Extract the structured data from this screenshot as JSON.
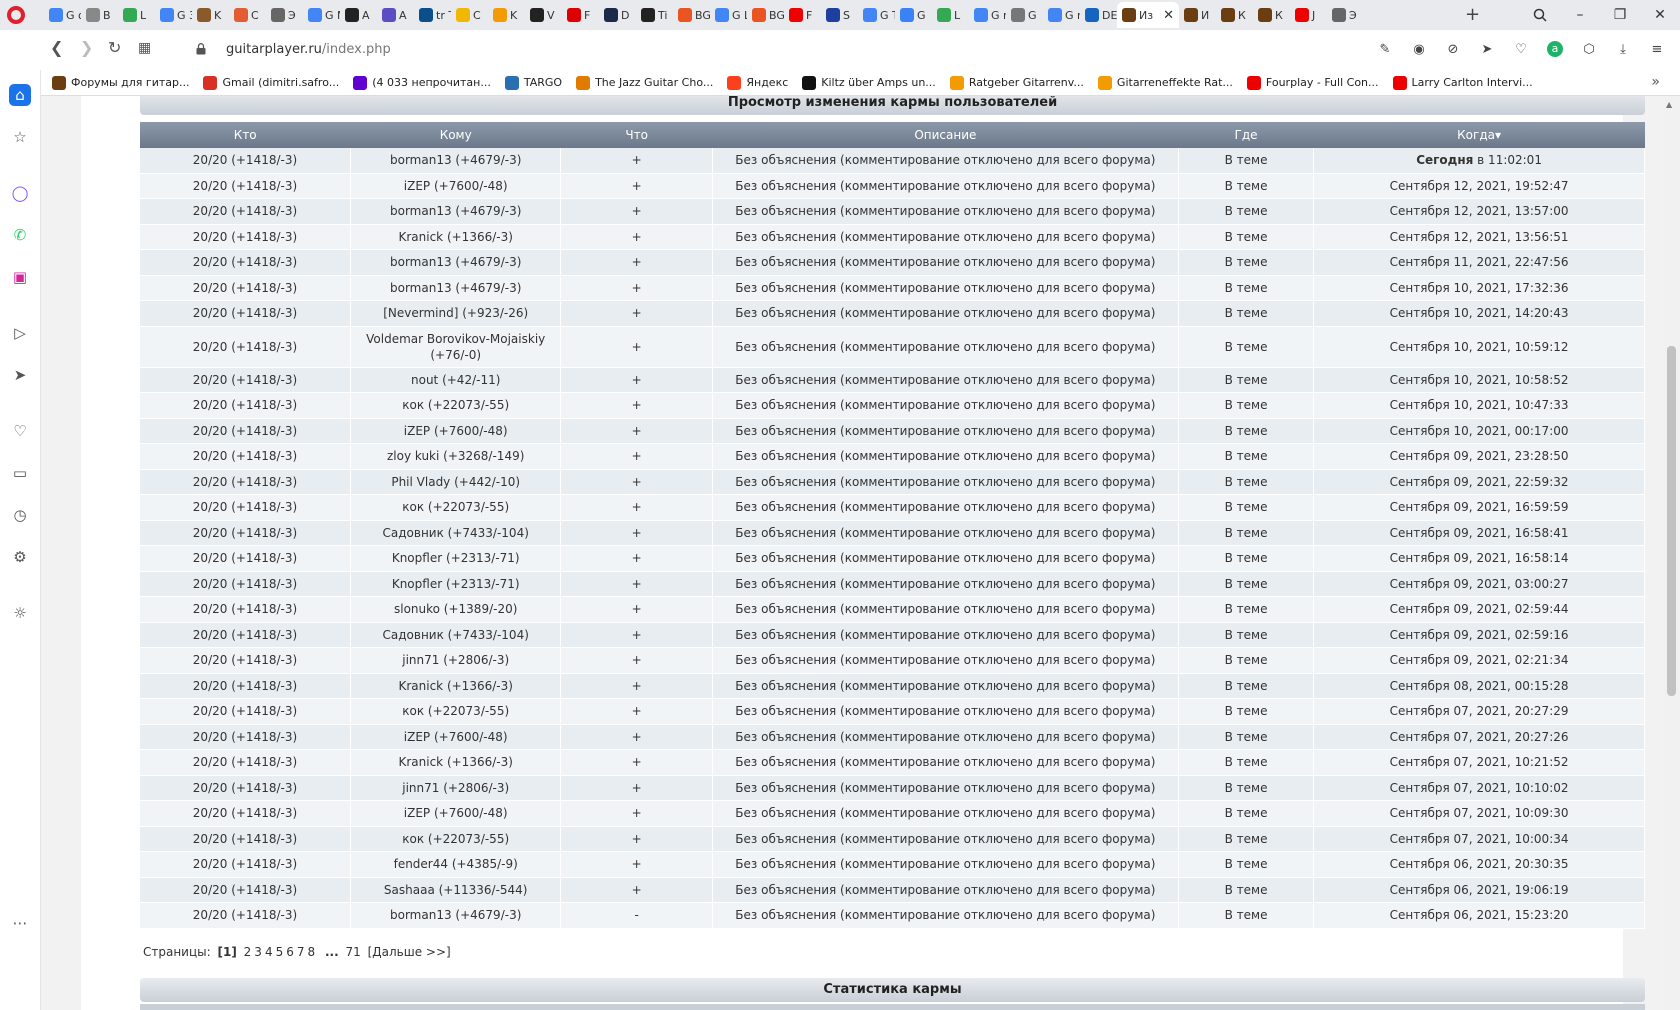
{
  "browser": {
    "tabs": [
      {
        "label": "G o",
        "color": "#4285f4"
      },
      {
        "label": "B",
        "color": "#888"
      },
      {
        "label": "L",
        "color": "#34a853"
      },
      {
        "label": "G 3",
        "color": "#4285f4"
      },
      {
        "label": "K",
        "color": "#8b5a2b"
      },
      {
        "label": "C",
        "color": "#e25d33"
      },
      {
        "label": "Э",
        "color": "#666"
      },
      {
        "label": "G M",
        "color": "#4285f4"
      },
      {
        "label": "A",
        "color": "#222"
      },
      {
        "label": "A",
        "color": "#5b4ec4"
      },
      {
        "label": "tr T",
        "color": "#0b4f8a"
      },
      {
        "label": "C",
        "color": "#f2b705"
      },
      {
        "label": "K",
        "color": "#f29b05"
      },
      {
        "label": "V",
        "color": "#222"
      },
      {
        "label": "F",
        "color": "#d00"
      },
      {
        "label": "D",
        "color": "#1b2a4a"
      },
      {
        "label": "Ti",
        "color": "#222"
      },
      {
        "label": "BG L",
        "color": "#e95420"
      },
      {
        "label": "G L",
        "color": "#4285f4"
      },
      {
        "label": "BG A",
        "color": "#e95420"
      },
      {
        "label": "F",
        "color": "#e00"
      },
      {
        "label": "S",
        "color": "#1f3fa0"
      },
      {
        "label": "G T",
        "color": "#4285f4"
      },
      {
        "label": "G",
        "color": "#3a82f7"
      },
      {
        "label": "L",
        "color": "#34a853"
      },
      {
        "label": "G r",
        "color": "#4285f4"
      },
      {
        "label": "G",
        "color": "#777"
      },
      {
        "label": "G r",
        "color": "#4285f4"
      },
      {
        "label": "DE h",
        "color": "#1565c0"
      }
    ],
    "active_tab": {
      "label": "Из",
      "color": "#6b3e12"
    },
    "tabs_after": [
      {
        "label": "И",
        "color": "#6b3e12"
      },
      {
        "label": "К",
        "color": "#6b3e12"
      },
      {
        "label": "К",
        "color": "#6b3e12"
      },
      {
        "label": "J",
        "color": "#e00"
      },
      {
        "label": "Э",
        "color": "#666"
      }
    ],
    "url_host": "guitarplayer.ru",
    "url_path": "/index.php",
    "bookmarks": [
      {
        "label": "Форумы для гитар...",
        "color": "#6b3e12"
      },
      {
        "label": "Gmail (dimitri.safro...",
        "color": "#d93025"
      },
      {
        "label": "(4 033 непрочитан...",
        "color": "#5f01d1"
      },
      {
        "label": "TARGO",
        "color": "#2a6fb0"
      },
      {
        "label": "The Jazz Guitar Cho...",
        "color": "#e07b00"
      },
      {
        "label": "Яндекс",
        "color": "#fc3f1d"
      },
      {
        "label": "Kiltz über Amps un...",
        "color": "#111"
      },
      {
        "label": "Ratgeber Gitarrenv...",
        "color": "#f29b05"
      },
      {
        "label": "Gitarreneffekte Rat...",
        "color": "#f29b05"
      },
      {
        "label": "Fourplay - Full Con...",
        "color": "#e00"
      },
      {
        "label": "Larry Carlton Intervi...",
        "color": "#e00"
      }
    ]
  },
  "page": {
    "title": "Просмотр изменения кармы пользователей",
    "columns": [
      "Кто",
      "Кому",
      "Что",
      "Описание",
      "Где",
      "Когда"
    ],
    "sort_indicator": "▾",
    "rows": [
      {
        "who": "20/20 (+1418/-3)",
        "to": "borman13 (+4679/-3)",
        "what": "+",
        "desc": "Без объяснения (комментирование отключено для всего форума)",
        "where": "В теме",
        "when_bold": "Сегодня",
        "when": " в 11:02:01"
      },
      {
        "who": "20/20 (+1418/-3)",
        "to": "iZEP (+7600/-48)",
        "what": "+",
        "desc": "Без объяснения (комментирование отключено для всего форума)",
        "where": "В теме",
        "when": "Сентября 12, 2021, 19:52:47"
      },
      {
        "who": "20/20 (+1418/-3)",
        "to": "borman13 (+4679/-3)",
        "what": "+",
        "desc": "Без объяснения (комментирование отключено для всего форума)",
        "where": "В теме",
        "when": "Сентября 12, 2021, 13:57:00"
      },
      {
        "who": "20/20 (+1418/-3)",
        "to": "Kranick (+1366/-3)",
        "what": "+",
        "desc": "Без объяснения (комментирование отключено для всего форума)",
        "where": "В теме",
        "when": "Сентября 12, 2021, 13:56:51"
      },
      {
        "who": "20/20 (+1418/-3)",
        "to": "borman13 (+4679/-3)",
        "what": "+",
        "desc": "Без объяснения (комментирование отключено для всего форума)",
        "where": "В теме",
        "when": "Сентября 11, 2021, 22:47:56"
      },
      {
        "who": "20/20 (+1418/-3)",
        "to": "borman13 (+4679/-3)",
        "what": "+",
        "desc": "Без объяснения (комментирование отключено для всего форума)",
        "where": "В теме",
        "when": "Сентября 10, 2021, 17:32:36"
      },
      {
        "who": "20/20 (+1418/-3)",
        "to": "[Nevermind] (+923/-26)",
        "what": "+",
        "desc": "Без объяснения (комментирование отключено для всего форума)",
        "where": "В теме",
        "when": "Сентября 10, 2021, 14:20:43"
      },
      {
        "who": "20/20 (+1418/-3)",
        "to": "Voldemar Borovikov-Mojaiskiy (+76/-0)",
        "what": "+",
        "desc": "Без объяснения (комментирование отключено для всего форума)",
        "where": "В теме",
        "when": "Сентября 10, 2021, 10:59:12",
        "tall": true
      },
      {
        "who": "20/20 (+1418/-3)",
        "to": "nout (+42/-11)",
        "what": "+",
        "desc": "Без объяснения (комментирование отключено для всего форума)",
        "where": "В теме",
        "when": "Сентября 10, 2021, 10:58:52"
      },
      {
        "who": "20/20 (+1418/-3)",
        "to": "кок (+22073/-55)",
        "what": "+",
        "desc": "Без объяснения (комментирование отключено для всего форума)",
        "where": "В теме",
        "when": "Сентября 10, 2021, 10:47:33"
      },
      {
        "who": "20/20 (+1418/-3)",
        "to": "iZEP (+7600/-48)",
        "what": "+",
        "desc": "Без объяснения (комментирование отключено для всего форума)",
        "where": "В теме",
        "when": "Сентября 10, 2021, 00:17:00"
      },
      {
        "who": "20/20 (+1418/-3)",
        "to": "zloy kuki (+3268/-149)",
        "what": "+",
        "desc": "Без объяснения (комментирование отключено для всего форума)",
        "where": "В теме",
        "when": "Сентября 09, 2021, 23:28:50"
      },
      {
        "who": "20/20 (+1418/-3)",
        "to": "Phil Vlady (+442/-10)",
        "what": "+",
        "desc": "Без объяснения (комментирование отключено для всего форума)",
        "where": "В теме",
        "when": "Сентября 09, 2021, 22:59:32"
      },
      {
        "who": "20/20 (+1418/-3)",
        "to": "кок (+22073/-55)",
        "what": "+",
        "desc": "Без объяснения (комментирование отключено для всего форума)",
        "where": "В теме",
        "when": "Сентября 09, 2021, 16:59:59"
      },
      {
        "who": "20/20 (+1418/-3)",
        "to": "Садовник (+7433/-104)",
        "what": "+",
        "desc": "Без объяснения (комментирование отключено для всего форума)",
        "where": "В теме",
        "when": "Сентября 09, 2021, 16:58:41"
      },
      {
        "who": "20/20 (+1418/-3)",
        "to": "Knopfler (+2313/-71)",
        "what": "+",
        "desc": "Без объяснения (комментирование отключено для всего форума)",
        "where": "В теме",
        "when": "Сентября 09, 2021, 16:58:14"
      },
      {
        "who": "20/20 (+1418/-3)",
        "to": "Knopfler (+2313/-71)",
        "what": "+",
        "desc": "Без объяснения (комментирование отключено для всего форума)",
        "where": "В теме",
        "when": "Сентября 09, 2021, 03:00:27"
      },
      {
        "who": "20/20 (+1418/-3)",
        "to": "slonuko (+1389/-20)",
        "what": "+",
        "desc": "Без объяснения (комментирование отключено для всего форума)",
        "where": "В теме",
        "when": "Сентября 09, 2021, 02:59:44"
      },
      {
        "who": "20/20 (+1418/-3)",
        "to": "Садовник (+7433/-104)",
        "what": "+",
        "desc": "Без объяснения (комментирование отключено для всего форума)",
        "where": "В теме",
        "when": "Сентября 09, 2021, 02:59:16"
      },
      {
        "who": "20/20 (+1418/-3)",
        "to": "jinn71 (+2806/-3)",
        "what": "+",
        "desc": "Без объяснения (комментирование отключено для всего форума)",
        "where": "В теме",
        "when": "Сентября 09, 2021, 02:21:34"
      },
      {
        "who": "20/20 (+1418/-3)",
        "to": "Kranick (+1366/-3)",
        "what": "+",
        "desc": "Без объяснения (комментирование отключено для всего форума)",
        "where": "В теме",
        "when": "Сентября 08, 2021, 00:15:28"
      },
      {
        "who": "20/20 (+1418/-3)",
        "to": "кок (+22073/-55)",
        "what": "+",
        "desc": "Без объяснения (комментирование отключено для всего форума)",
        "where": "В теме",
        "when": "Сентября 07, 2021, 20:27:29"
      },
      {
        "who": "20/20 (+1418/-3)",
        "to": "iZEP (+7600/-48)",
        "what": "+",
        "desc": "Без объяснения (комментирование отключено для всего форума)",
        "where": "В теме",
        "when": "Сентября 07, 2021, 20:27:26"
      },
      {
        "who": "20/20 (+1418/-3)",
        "to": "Kranick (+1366/-3)",
        "what": "+",
        "desc": "Без объяснения (комментирование отключено для всего форума)",
        "where": "В теме",
        "when": "Сентября 07, 2021, 10:21:52"
      },
      {
        "who": "20/20 (+1418/-3)",
        "to": "jinn71 (+2806/-3)",
        "what": "+",
        "desc": "Без объяснения (комментирование отключено для всего форума)",
        "where": "В теме",
        "when": "Сентября 07, 2021, 10:10:02"
      },
      {
        "who": "20/20 (+1418/-3)",
        "to": "iZEP (+7600/-48)",
        "what": "+",
        "desc": "Без объяснения (комментирование отключено для всего форума)",
        "where": "В теме",
        "when": "Сентября 07, 2021, 10:09:30"
      },
      {
        "who": "20/20 (+1418/-3)",
        "to": "кок (+22073/-55)",
        "what": "+",
        "desc": "Без объяснения (комментирование отключено для всего форума)",
        "where": "В теме",
        "when": "Сентября 07, 2021, 10:00:34"
      },
      {
        "who": "20/20 (+1418/-3)",
        "to": "fender44 (+4385/-9)",
        "what": "+",
        "desc": "Без объяснения (комментирование отключено для всего форума)",
        "where": "В теме",
        "when": "Сентября 06, 2021, 20:30:35"
      },
      {
        "who": "20/20 (+1418/-3)",
        "to": "Sashaaa (+11336/-544)",
        "what": "+",
        "desc": "Без объяснения (комментирование отключено для всего форума)",
        "where": "В теме",
        "when": "Сентября 06, 2021, 19:06:19"
      },
      {
        "who": "20/20 (+1418/-3)",
        "to": "borman13 (+4679/-3)",
        "what": "-",
        "desc": "Без объяснения (комментирование отключено для всего форума)",
        "where": "В теме",
        "when": "Сентября 06, 2021, 15:23:20"
      }
    ],
    "pager": {
      "label": "Страницы:",
      "current": "[1]",
      "pages": [
        "2",
        "3",
        "4",
        "5",
        "6",
        "7",
        "8"
      ],
      "ellipsis": "...",
      "last": "71",
      "next": "[Дальше >>]"
    },
    "stats_title": "Статистика кармы"
  }
}
